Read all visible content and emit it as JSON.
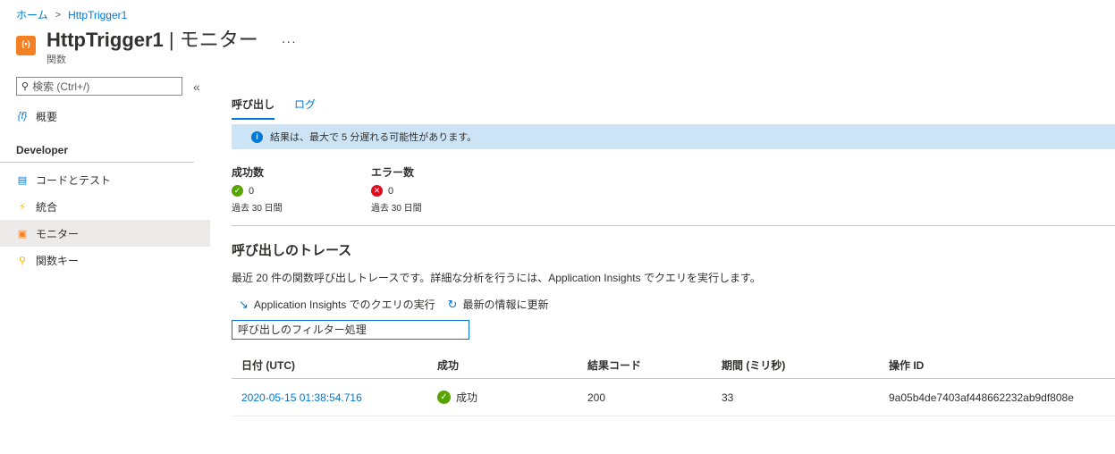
{
  "breadcrumb": {
    "home": "ホーム",
    "current": "HttpTrigger1"
  },
  "header": {
    "name": "HttpTrigger1",
    "separator": " | ",
    "section": "モニター",
    "subtitle": "関数",
    "more": "···"
  },
  "sidebar": {
    "search_placeholder": "検索 (Ctrl+/)",
    "collapse": "«",
    "overview": {
      "icon": "function-icon",
      "label": "概要"
    },
    "section": "Developer",
    "items": [
      {
        "icon": "code-icon",
        "label": "コードとテスト"
      },
      {
        "icon": "lightning-icon",
        "label": "統合"
      },
      {
        "icon": "monitor-icon",
        "label": "モニター"
      },
      {
        "icon": "key-icon",
        "label": "関数キー"
      }
    ]
  },
  "tabs": [
    {
      "label": "呼び出し"
    },
    {
      "label": "ログ"
    }
  ],
  "info": {
    "text": "結果は、最大で 5 分遅れる可能性があります。"
  },
  "stats": {
    "success": {
      "title": "成功数",
      "value": "0",
      "period": "過去 30 日間"
    },
    "error": {
      "title": "エラー数",
      "value": "0",
      "period": "過去 30 日間"
    }
  },
  "traces": {
    "title": "呼び出しのトレース",
    "description": "最近 20 件の関数呼び出しトレースです。詳細な分析を行うには、Application Insights でクエリを実行します。",
    "run_query": "Application Insights でのクエリの実行",
    "refresh": "最新の情報に更新",
    "filter_placeholder": "呼び出しのフィルター処理"
  },
  "table": {
    "headers": [
      "日付 (UTC)",
      "成功",
      "結果コード",
      "期間 (ミリ秒)",
      "操作 ID"
    ],
    "rows": [
      {
        "date": "2020-05-15 01:38:54.716",
        "success": "成功",
        "code": "200",
        "duration": "33",
        "operation_id": "9a05b4de7403af448662232ab9df808e"
      }
    ]
  },
  "colors": {
    "accent": "#0078d4",
    "success": "#57a300",
    "error": "#e00b1c",
    "info_bg": "#cce4f6"
  }
}
